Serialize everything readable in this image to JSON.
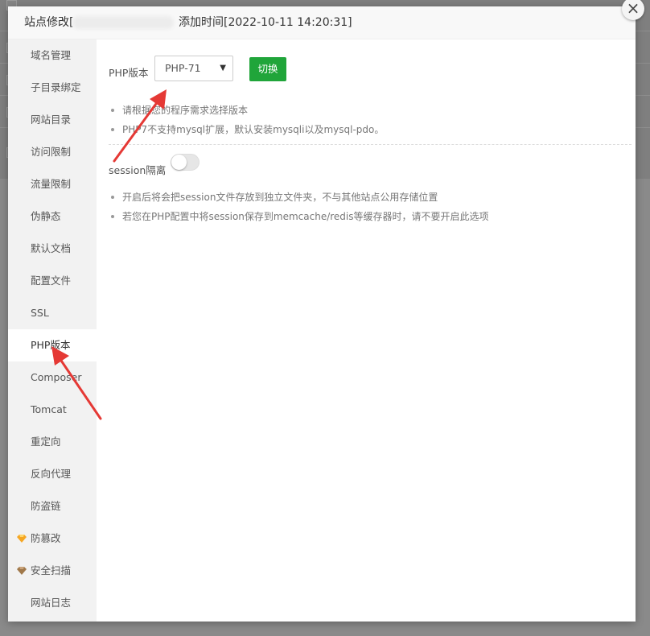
{
  "dialog": {
    "title_prefix": "站点修改[",
    "title_time": "添加时间[2022-10-11 14:20:31]",
    "close_glyph": "×"
  },
  "sidebar": {
    "items": [
      {
        "label": "域名管理"
      },
      {
        "label": "子目录绑定"
      },
      {
        "label": "网站目录"
      },
      {
        "label": "访问限制"
      },
      {
        "label": "流量限制"
      },
      {
        "label": "伪静态"
      },
      {
        "label": "默认文档"
      },
      {
        "label": "配置文件"
      },
      {
        "label": "SSL"
      },
      {
        "label": "PHP版本",
        "active": true
      },
      {
        "label": "Composer"
      },
      {
        "label": "Tomcat"
      },
      {
        "label": "重定向"
      },
      {
        "label": "反向代理"
      },
      {
        "label": "防盗链"
      },
      {
        "label": "防篡改",
        "icon": "gem-gold-icon"
      },
      {
        "label": "安全扫描",
        "icon": "gem-brown-icon"
      },
      {
        "label": "网站日志"
      }
    ]
  },
  "php": {
    "label": "PHP版本",
    "selected": "PHP-71",
    "switch_label": "切换",
    "tips": [
      "请根据您的程序需求选择版本",
      "PHP7不支持mysql扩展，默认安装mysqli以及mysql-pdo。"
    ]
  },
  "session": {
    "label": "session隔离",
    "enabled": false,
    "tips": [
      "开启后将会把session文件存放到独立文件夹，不与其他站点公用存储位置",
      "若您在PHP配置中将session保存到memcache/redis等缓存器时，请不要开启此选项"
    ]
  },
  "colors": {
    "accent": "#20a53a",
    "annotation": "#e53935"
  }
}
